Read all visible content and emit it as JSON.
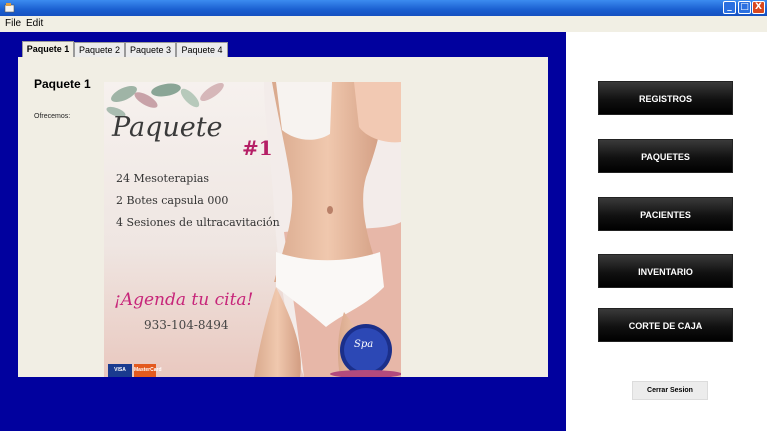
{
  "window": {
    "min": "_",
    "max": "□",
    "close": "X"
  },
  "menu": {
    "file": "File",
    "edit": "Edit"
  },
  "tabs": [
    "Paquete 1",
    "Paquete 2",
    "Paquete 3",
    "Paquete 4"
  ],
  "content": {
    "title": "Paquete 1",
    "offer_label": "Ofrecemos:",
    "promo": {
      "heading": "Paquete",
      "number": "#1",
      "line1": "24 Mesoterapias",
      "line2": "2 Botes capsula 000",
      "line3": "4 Sesiones  de ultracavitación",
      "cta": "¡Agenda tu cita!",
      "phone": "933-104-8494",
      "card1": "VISA",
      "card2": "MasterCard",
      "logo_text": "Spa"
    }
  },
  "nav": {
    "registros": "REGISTROS",
    "paquetes": "PAQUETES",
    "pacientes": "PACIENTES",
    "inventario": "INVENTARIO",
    "corte": "CORTE DE CAJA",
    "logout": "Cerrar Sesion"
  },
  "colors": {
    "left_panel": "#01019e",
    "accent_pink": "#c7267a",
    "button": "#111111"
  }
}
